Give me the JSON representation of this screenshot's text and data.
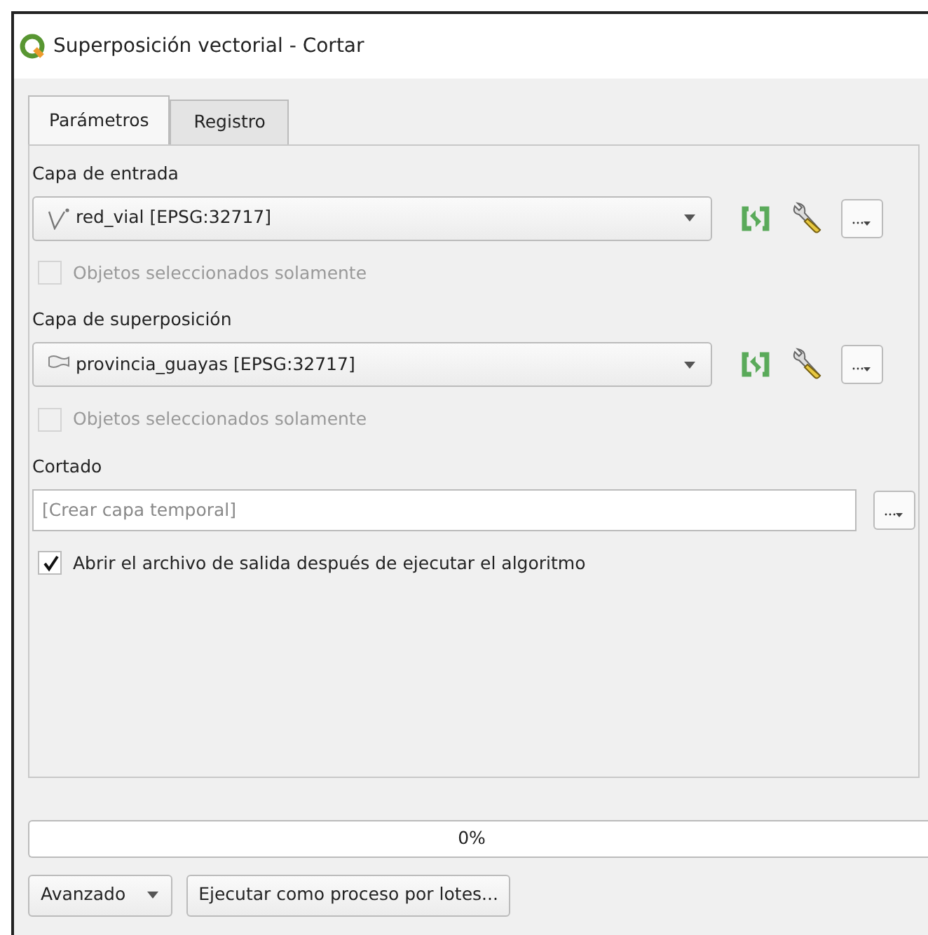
{
  "window": {
    "title": "Superposición vectorial - Cortar"
  },
  "tabs": [
    {
      "label": "Parámetros",
      "selected": true
    },
    {
      "label": "Registro",
      "selected": false
    }
  ],
  "inputs": [
    {
      "label": "Capa de entrada",
      "value": "red_vial [EPSG:32717]",
      "kind": "line",
      "selected_only": {
        "label": "Objetos seleccionados solamente",
        "checked": false,
        "disabled": true
      }
    },
    {
      "label": "Capa de superposición",
      "value": "provincia_guayas [EPSG:32717]",
      "kind": "polygon",
      "selected_only": {
        "label": "Objetos seleccionados solamente",
        "checked": false,
        "disabled": true
      }
    }
  ],
  "output": {
    "label": "Cortado",
    "placeholder": "[Crear capa temporal]"
  },
  "open_after": {
    "label": "Abrir el archivo de salida después de ejecutar el algoritmo",
    "checked": true,
    "disabled": false
  },
  "progress": {
    "text": "0%"
  },
  "buttons": [
    {
      "label": "Avanzado",
      "kind": "dropdown"
    },
    {
      "label": "Ejecutar como proceso por lotes...",
      "kind": "plain"
    }
  ]
}
